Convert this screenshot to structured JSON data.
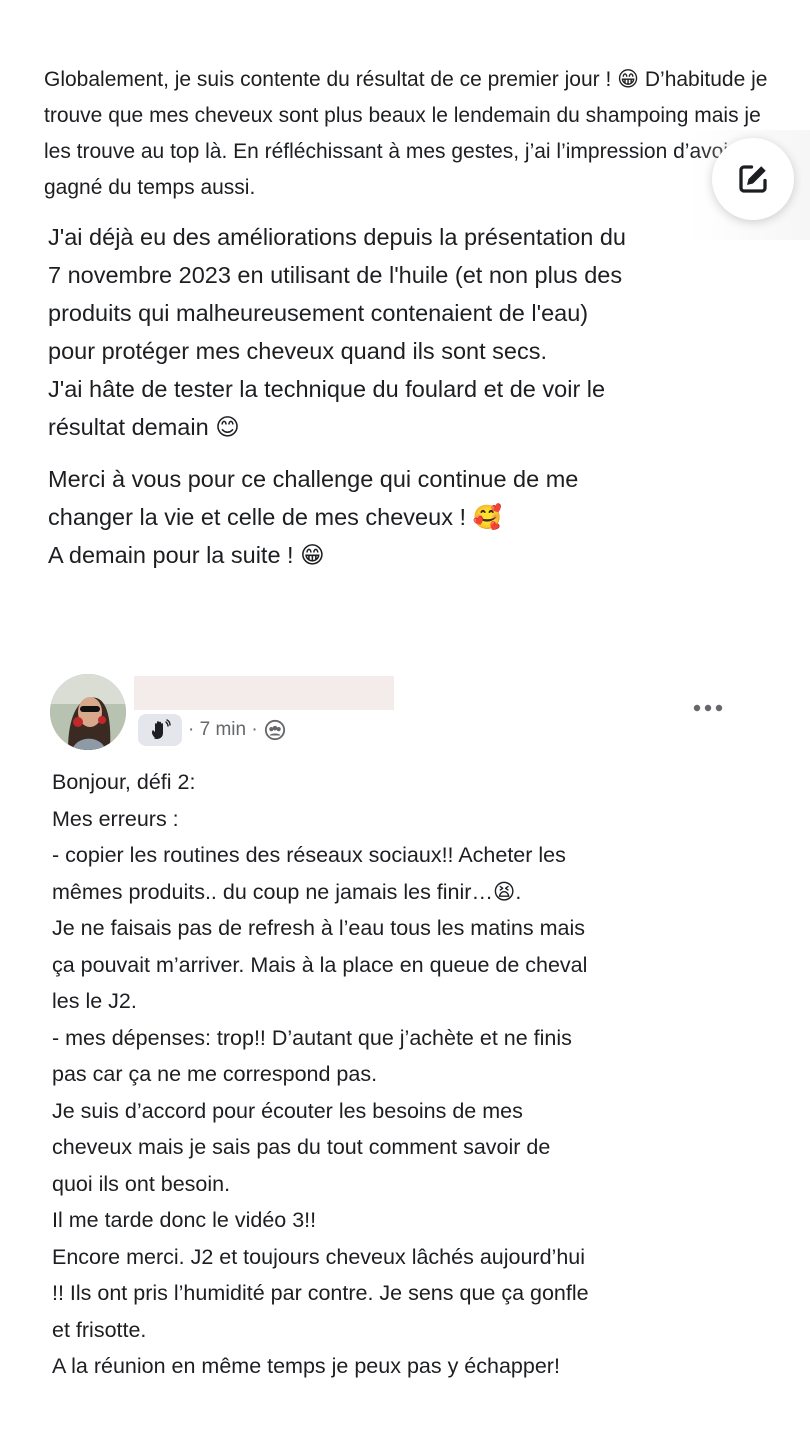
{
  "previous_post": {
    "paragraph1": "Globalement, je suis contente du résultat de ce premier jour ! 😁 D’habitude je trouve que mes cheveux sont plus beaux le lendemain du shampoing mais je les trouve au top là. En réfléchissant à mes gestes, j’ai l’impression d’avoir gagné du temps aussi.",
    "paragraph2": "J'ai déjà eu des améliorations depuis la présentation du\n7 novembre 2023 en utilisant de l'huile (et non plus des\nproduits qui malheureusement contenaient de l'eau)\npour protéger mes cheveux quand ils sont secs.\nJ'ai hâte de tester la technique du foulard et de voir le\nrésultat demain 😊",
    "paragraph3": "Merci à vous pour ce challenge qui continue de me\nchanger la vie et celle de mes cheveux ! 🥰\nA demain pour la suite ! 😁"
  },
  "edit_button": {
    "icon": "edit-icon"
  },
  "comment": {
    "author_name": "",
    "badge_icon": "waving-hand-icon",
    "time": "· 7 min ·",
    "audience_icon": "group-icon",
    "more_icon": "more-horizontal-icon",
    "text": "Bonjour, défi 2:\nMes erreurs :\n- copier les routines des réseaux sociaux!!  Acheter les\nmêmes produits.. du coup ne jamais les finir…😫.\nJe ne faisais pas de refresh à l’eau tous les matins mais\nça pouvait m’arriver. Mais à la place en queue de cheval\nles le J2.\n- mes dépenses: trop!! D’autant que j’achète et ne finis\npas car ça ne me correspond pas.\nJe suis d’accord pour écouter les besoins de mes\ncheveux mais je sais pas du tout comment savoir de\nquoi ils ont besoin.\nIl me tarde donc le vidéo 3!!\nEncore merci. J2 et toujours cheveux lâchés aujourd’hui\n!! Ils ont pris l’humidité par contre. Je sens que ça gonfle\net frisotte.\nA la réunion en même temps je peux pas y échapper!"
  }
}
